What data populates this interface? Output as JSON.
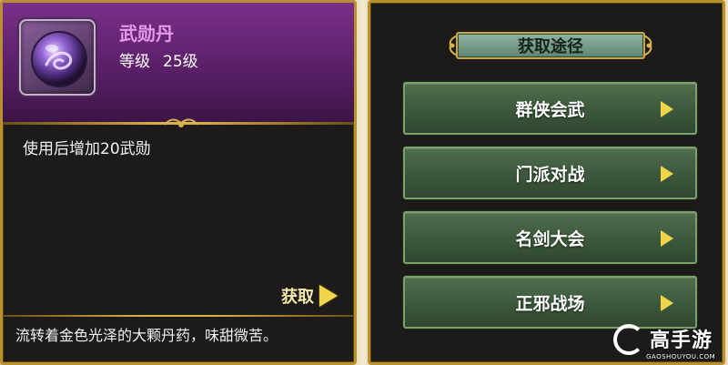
{
  "item": {
    "name": "武勋丹",
    "level_label": "等级",
    "level_value": "25级",
    "description": "使用后增加20武勋",
    "get_label": "获取",
    "flavor": "流转着金色光泽的大颗丹药，味甜微苦。"
  },
  "sources": {
    "title": "获取途径",
    "items": [
      {
        "label": "群侠会武"
      },
      {
        "label": "门派对战"
      },
      {
        "label": "名剑大会"
      },
      {
        "label": "正邪战场"
      }
    ]
  },
  "watermark": {
    "text": "高手游",
    "sub": "GAOSHOUYOU.COM"
  },
  "colors": {
    "accent_gold": "#b8912e",
    "item_name": "#e59ae8",
    "arrow_yellow": "#f0d54a",
    "button_green": "#3e5a3d"
  },
  "icons": {
    "item": "purple-orb-icon",
    "arrow": "triangle-right-icon"
  }
}
